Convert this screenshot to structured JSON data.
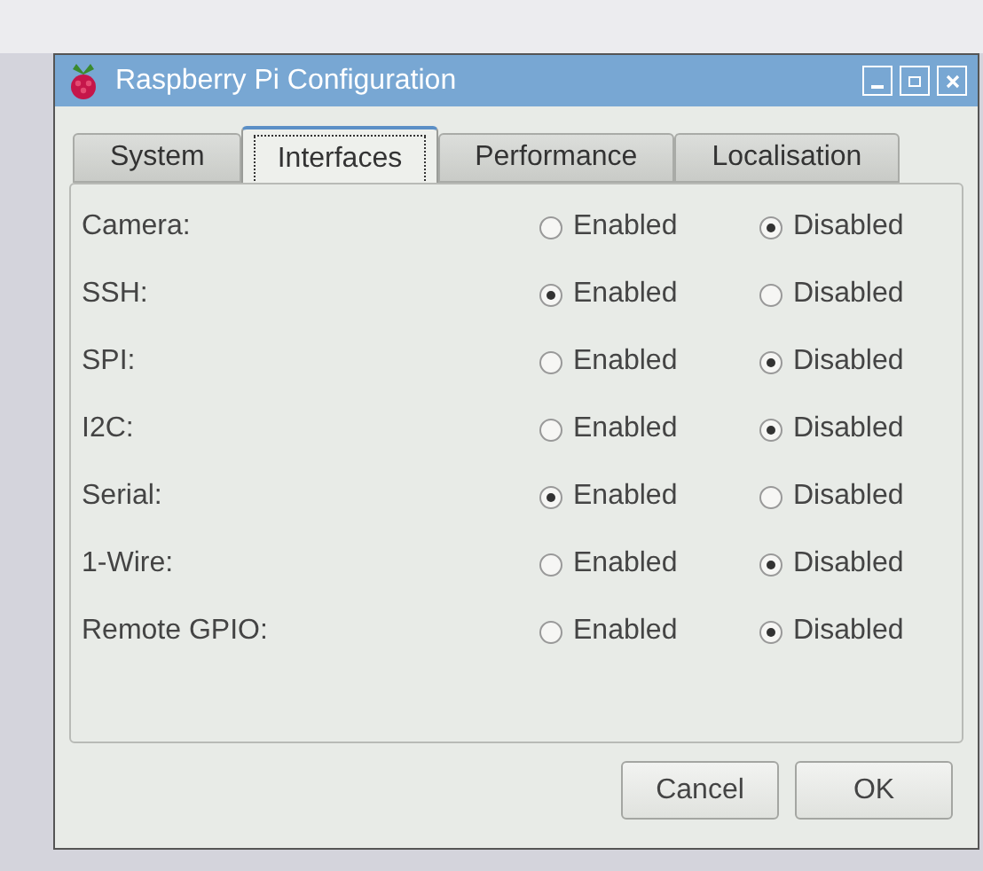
{
  "window": {
    "title": "Raspberry Pi Configuration"
  },
  "tabs": [
    {
      "label": "System",
      "selected": false
    },
    {
      "label": "Interfaces",
      "selected": true
    },
    {
      "label": "Performance",
      "selected": false
    },
    {
      "label": "Localisation",
      "selected": false
    }
  ],
  "options": [
    {
      "label": "Camera:",
      "enabled_label": "Enabled",
      "disabled_label": "Disabled",
      "enabled": false
    },
    {
      "label": "SSH:",
      "enabled_label": "Enabled",
      "disabled_label": "Disabled",
      "enabled": true
    },
    {
      "label": "SPI:",
      "enabled_label": "Enabled",
      "disabled_label": "Disabled",
      "enabled": false
    },
    {
      "label": "I2C:",
      "enabled_label": "Enabled",
      "disabled_label": "Disabled",
      "enabled": false
    },
    {
      "label": "Serial:",
      "enabled_label": "Enabled",
      "disabled_label": "Disabled",
      "enabled": true
    },
    {
      "label": "1-Wire:",
      "enabled_label": "Enabled",
      "disabled_label": "Disabled",
      "enabled": false
    },
    {
      "label": "Remote GPIO:",
      "enabled_label": "Enabled",
      "disabled_label": "Disabled",
      "enabled": false
    }
  ],
  "buttons": [
    "Cancel",
    "OK"
  ]
}
